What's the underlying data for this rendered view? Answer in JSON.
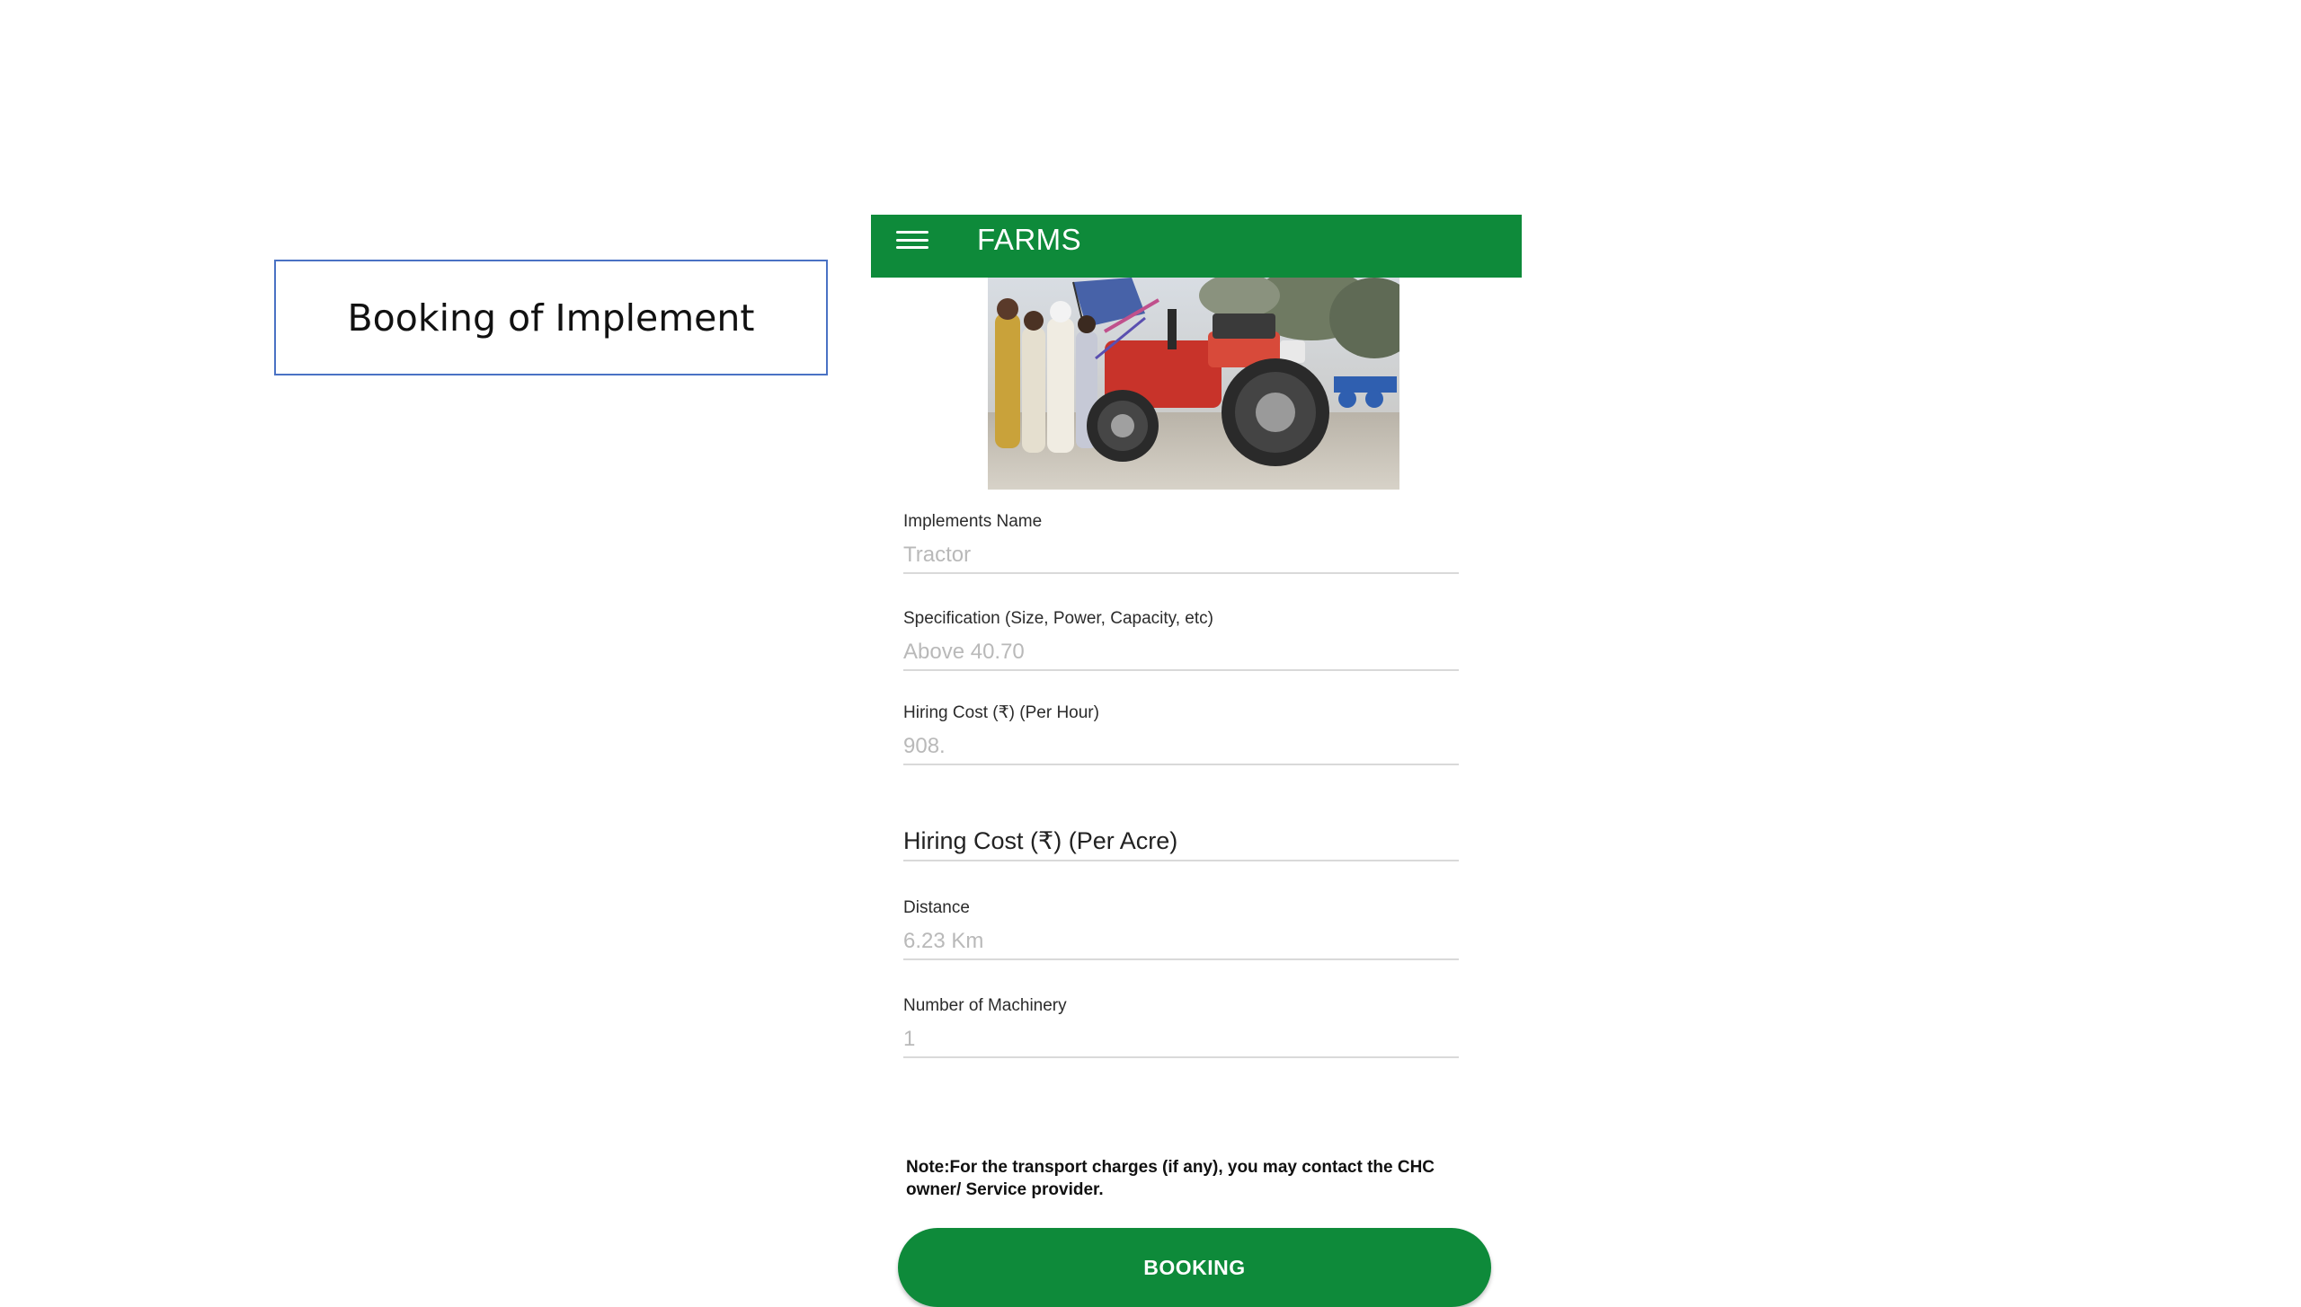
{
  "slide": {
    "label": "Booking of Implement"
  },
  "app_bar": {
    "menu_icon": "hamburger-menu-icon",
    "title": "FARMS"
  },
  "photo": {
    "subject": "tractor-photo"
  },
  "form": {
    "implements_name": {
      "label": "Implements Name",
      "value": "Tractor"
    },
    "specification": {
      "label": "Specification (Size, Power, Capacity, etc)",
      "value": "Above 40.70"
    },
    "hiring_cost_hour": {
      "label": "Hiring Cost (₹) (Per Hour)",
      "value": "908."
    },
    "hiring_cost_acre": {
      "label": "Hiring Cost (₹) (Per Acre)"
    },
    "distance": {
      "label": "Distance",
      "value": "6.23 Km"
    },
    "machinery_count": {
      "label": "Number of Machinery",
      "value": "1"
    }
  },
  "note": {
    "text": "Note:For the transport charges (if any), you may contact the CHC owner/ Service provider."
  },
  "actions": {
    "booking_label": "BOOKING"
  },
  "colors": {
    "app_green": "#0e8a3a",
    "label_border": "#4a72c4"
  }
}
